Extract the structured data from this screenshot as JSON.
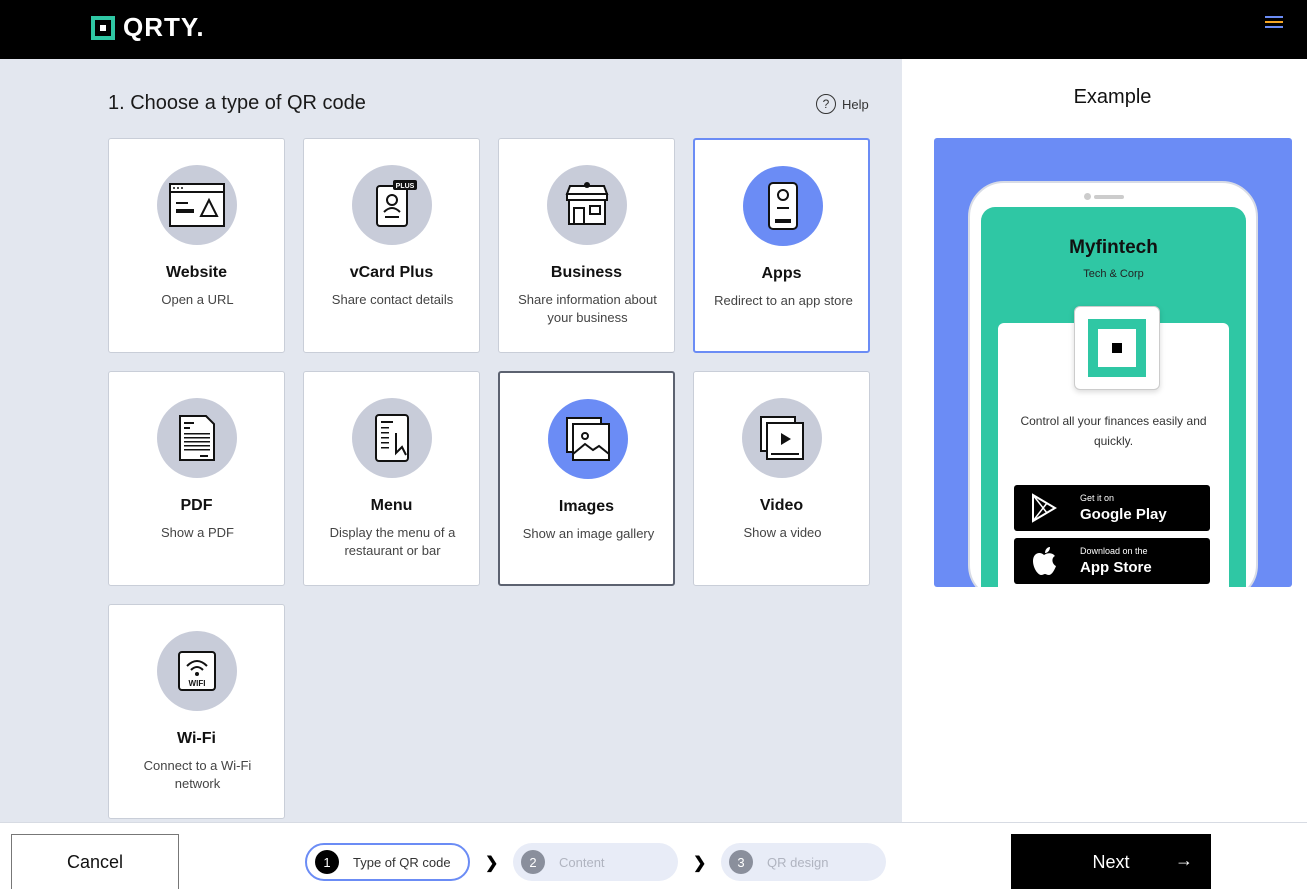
{
  "header": {
    "logo_text": "QRTY.",
    "menu_colors": [
      "#6b8cf5",
      "#f5a623",
      "#6b8cf5"
    ]
  },
  "main": {
    "heading": "1. Choose a type of QR code",
    "help_label": "Help",
    "help_icon": "?",
    "cards": [
      {
        "title": "Website",
        "desc": "Open a URL",
        "icon": "website-icon"
      },
      {
        "title": "vCard Plus",
        "desc": "Share contact details",
        "icon": "vcard-icon",
        "badge": "PLUS"
      },
      {
        "title": "Business",
        "desc": "Share information about your business",
        "icon": "store-icon"
      },
      {
        "title": "Apps",
        "desc": "Redirect to an app store",
        "icon": "phone-icon",
        "state": "selected"
      },
      {
        "title": "PDF",
        "desc": "Show a PDF",
        "icon": "pdf-icon"
      },
      {
        "title": "Menu",
        "desc": "Display the menu of a restaurant or bar",
        "icon": "menu-icon"
      },
      {
        "title": "Images",
        "desc": "Show an image gallery",
        "icon": "images-icon",
        "state": "hover"
      },
      {
        "title": "Video",
        "desc": "Show a video",
        "icon": "video-icon"
      },
      {
        "title": "Wi-Fi",
        "desc": "Connect to a Wi-Fi network",
        "icon": "wifi-icon",
        "badge": "WIFI"
      }
    ]
  },
  "example": {
    "title": "Example",
    "app_name": "Myfintech",
    "app_sub": "Tech & Corp",
    "app_desc": "Control all your finances easily and quickly.",
    "google": {
      "small": "Get it on",
      "big": "Google Play"
    },
    "apple": {
      "small": "Download on the",
      "big": "App Store"
    },
    "accent_color": "#2fc7a4",
    "preview_bg": "#6b8cf5"
  },
  "footer": {
    "cancel_label": "Cancel",
    "next_label": "Next",
    "next_arrow": "→",
    "steps": [
      {
        "num": "1",
        "label": "Type of QR code",
        "active": true
      },
      {
        "num": "2",
        "label": "Content",
        "active": false
      },
      {
        "num": "3",
        "label": "QR design",
        "active": false
      }
    ]
  }
}
